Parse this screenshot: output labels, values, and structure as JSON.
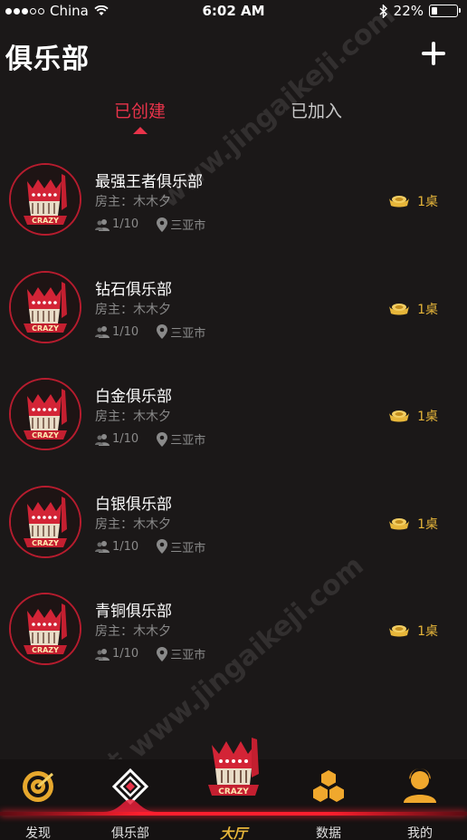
{
  "status_bar": {
    "carrier": "China",
    "time": "6:02 AM",
    "battery_percent": "22%",
    "battery_level": 0.22
  },
  "header": {
    "title": "俱乐部",
    "add_icon": "plus-icon"
  },
  "tabs": [
    {
      "label": "已创建",
      "active": true
    },
    {
      "label": "已加入",
      "active": false
    }
  ],
  "clubs": [
    {
      "name": "最强王者俱乐部",
      "owner": "房主：木木夕",
      "members": "1/10",
      "city": "三亚市",
      "tables": "1桌"
    },
    {
      "name": "钻石俱乐部",
      "owner": "房主：木木夕",
      "members": "1/10",
      "city": "三亚市",
      "tables": "1桌"
    },
    {
      "name": "白金俱乐部",
      "owner": "房主：木木夕",
      "members": "1/10",
      "city": "三亚市",
      "tables": "1桌"
    },
    {
      "name": "白银俱乐部",
      "owner": "房主：木木夕",
      "members": "1/10",
      "city": "三亚市",
      "tables": "1桌"
    },
    {
      "name": "青铜俱乐部",
      "owner": "房主：木木夕",
      "members": "1/10",
      "city": "三亚市",
      "tables": "1桌"
    }
  ],
  "bottom_nav": [
    {
      "label": "发现",
      "icon": "target-icon"
    },
    {
      "label": "俱乐部",
      "icon": "diamond-icon"
    },
    {
      "label": "大厅",
      "icon": "crazy-logo-icon"
    },
    {
      "label": "数据",
      "icon": "hexagons-icon"
    },
    {
      "label": "我的",
      "icon": "user-icon"
    }
  ],
  "watermark": {
    "text_top": "www.jingaikeji.com",
    "text_bottom": "金钛科技 www.jingaikeji.com"
  },
  "colors": {
    "accent": "#e8334a",
    "gold": "#e7b63a",
    "background": "#1b1818"
  }
}
